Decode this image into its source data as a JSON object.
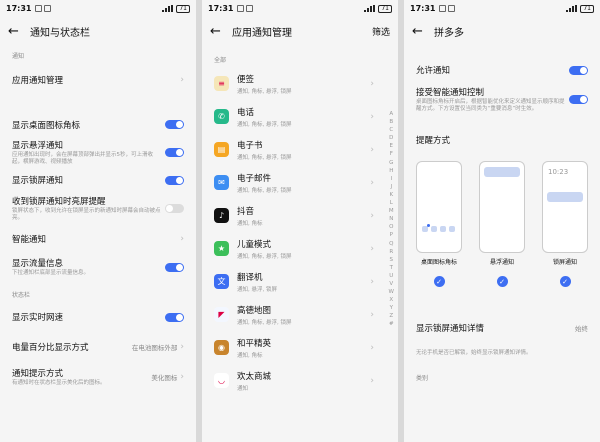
{
  "status": {
    "time": "17:31",
    "battery": "71"
  },
  "screen1": {
    "title": "通知与状态栏",
    "section_notify": "通知",
    "app_manage": "应用通知管理",
    "rows": [
      {
        "label": "显示桌面图标角标",
        "sub": "",
        "on": true
      },
      {
        "label": "显示悬浮通知",
        "sub": "应用通知出现时，会在屏幕顶部弹出并显示5秒，可上滑收起，横屏游戏、视频播放",
        "on": true
      },
      {
        "label": "显示锁屏通知",
        "sub": "",
        "on": true
      },
      {
        "label": "收到锁屏通知时亮屏提醒",
        "sub": "锁屏状态下，收到允许在锁屏显示的新通知时屏幕会自动被点亮。",
        "on": false
      }
    ],
    "smart_notify": "智能通知",
    "traffic": {
      "label": "显示流量信息",
      "sub": "下拉通知栏底部显示流量信息。",
      "on": true
    },
    "section_status": "状态栏",
    "netspeed": {
      "label": "显示实时网速",
      "on": true
    },
    "battery_pct": {
      "label": "电量百分比显示方式",
      "value": "在电池图标外部"
    },
    "notify_hint": {
      "label": "通知提示方式",
      "sub": "有通知时在状态栏显示美化后的图标。",
      "value": "美化图标"
    }
  },
  "screen2": {
    "title": "应用通知管理",
    "filter": "筛选",
    "section": "全部",
    "apps": [
      {
        "name": "便签",
        "desc": "通知, 角标, 悬浮, 锁屏",
        "color": "#f5e6b8",
        "glyph": "≡"
      },
      {
        "name": "电话",
        "desc": "通知, 角标, 悬浮, 锁屏",
        "color": "#26b98a",
        "glyph": "✆"
      },
      {
        "name": "电子书",
        "desc": "通知, 角标, 悬浮, 锁屏",
        "color": "#f5a623",
        "glyph": "▤"
      },
      {
        "name": "电子邮件",
        "desc": "通知, 角标, 悬浮, 锁屏",
        "color": "#3d8ef2",
        "glyph": "✉"
      },
      {
        "name": "抖音",
        "desc": "通知, 角标",
        "color": "#111111",
        "glyph": "♪"
      },
      {
        "name": "儿童模式",
        "desc": "通知, 角标, 悬浮, 锁屏",
        "color": "#3cbf5a",
        "glyph": "★"
      },
      {
        "name": "翻译机",
        "desc": "通知, 悬浮, 锁屏",
        "color": "#3d6ef2",
        "glyph": "文"
      },
      {
        "name": "高德地图",
        "desc": "通知, 角标, 悬浮, 锁屏",
        "color": "#f3f7ff",
        "glyph": "◤"
      },
      {
        "name": "和平精英",
        "desc": "通知, 角标",
        "color": "#c8842c",
        "glyph": "◉"
      },
      {
        "name": "欢太商城",
        "desc": "通知",
        "color": "#ffffff",
        "glyph": "◡"
      }
    ],
    "alphabet": [
      "A",
      "B",
      "C",
      "D",
      "E",
      "F",
      "G",
      "H",
      "I",
      "J",
      "K",
      "L",
      "M",
      "N",
      "O",
      "P",
      "Q",
      "R",
      "S",
      "T",
      "U",
      "V",
      "W",
      "X",
      "Y",
      "Z",
      "#"
    ]
  },
  "screen3": {
    "title": "拼多多",
    "allow": {
      "label": "允许通知",
      "on": true
    },
    "smart": {
      "label": "接受智能通知控制",
      "sub": "桌面图标角标开启后，根据智能优化来定义通知显示顺序和提醒方式。下方设置仅当同类为“重要消息”时生效。",
      "on": true
    },
    "remind_section": "提醒方式",
    "cards": [
      {
        "label": "桌面图标角标"
      },
      {
        "label": "悬浮通知"
      },
      {
        "label": "锁屏通知",
        "clock": "10:23"
      }
    ],
    "lock_detail": {
      "label": "显示锁屏通知详情",
      "value": "始终"
    },
    "lock_detail_sub": "无论手机是否已解锁，始终显示锁屏通知详情。",
    "category": "类别"
  }
}
